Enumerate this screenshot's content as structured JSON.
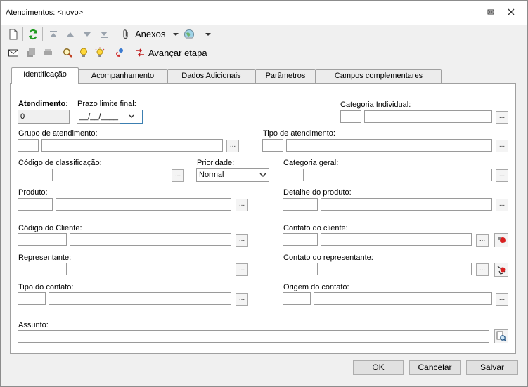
{
  "window": {
    "title": "Atendimentos: <novo>"
  },
  "toolbar1": {
    "anexos_label": "Anexos"
  },
  "toolbar2": {
    "avancar_label": "Avançar etapa"
  },
  "tabs": [
    {
      "label": "Identificação"
    },
    {
      "label": "Acompanhamento"
    },
    {
      "label": "Dados Adicionais"
    },
    {
      "label": "Parâmetros"
    },
    {
      "label": "Campos complementares"
    }
  ],
  "form": {
    "atendimento_label": "Atendimento:",
    "atendimento_value": "0",
    "prazo_label": "Prazo limite final:",
    "prazo_value": "__/__/____",
    "categoria_individual_label": "Categoria Individual:",
    "grupo_label": "Grupo de atendimento:",
    "tipo_atendimento_label": "Tipo de atendimento:",
    "codigo_class_label": "Código de classificação:",
    "prioridade_label": "Prioridade:",
    "prioridade_value": "Normal",
    "categoria_geral_label": "Categoria geral:",
    "produto_label": "Produto:",
    "detalhe_produto_label": "Detalhe do produto:",
    "codigo_cliente_label": "Código do Cliente:",
    "contato_cliente_label": "Contato do cliente:",
    "representante_label": "Representante:",
    "contato_representante_label": "Contato do representante:",
    "tipo_contato_label": "Tipo do contato:",
    "origem_contato_label": "Origem do contato:",
    "assunto_label": "Assunto:",
    "dots": "..."
  },
  "buttons": {
    "ok": "OK",
    "cancel": "Cancelar",
    "save": "Salvar"
  }
}
